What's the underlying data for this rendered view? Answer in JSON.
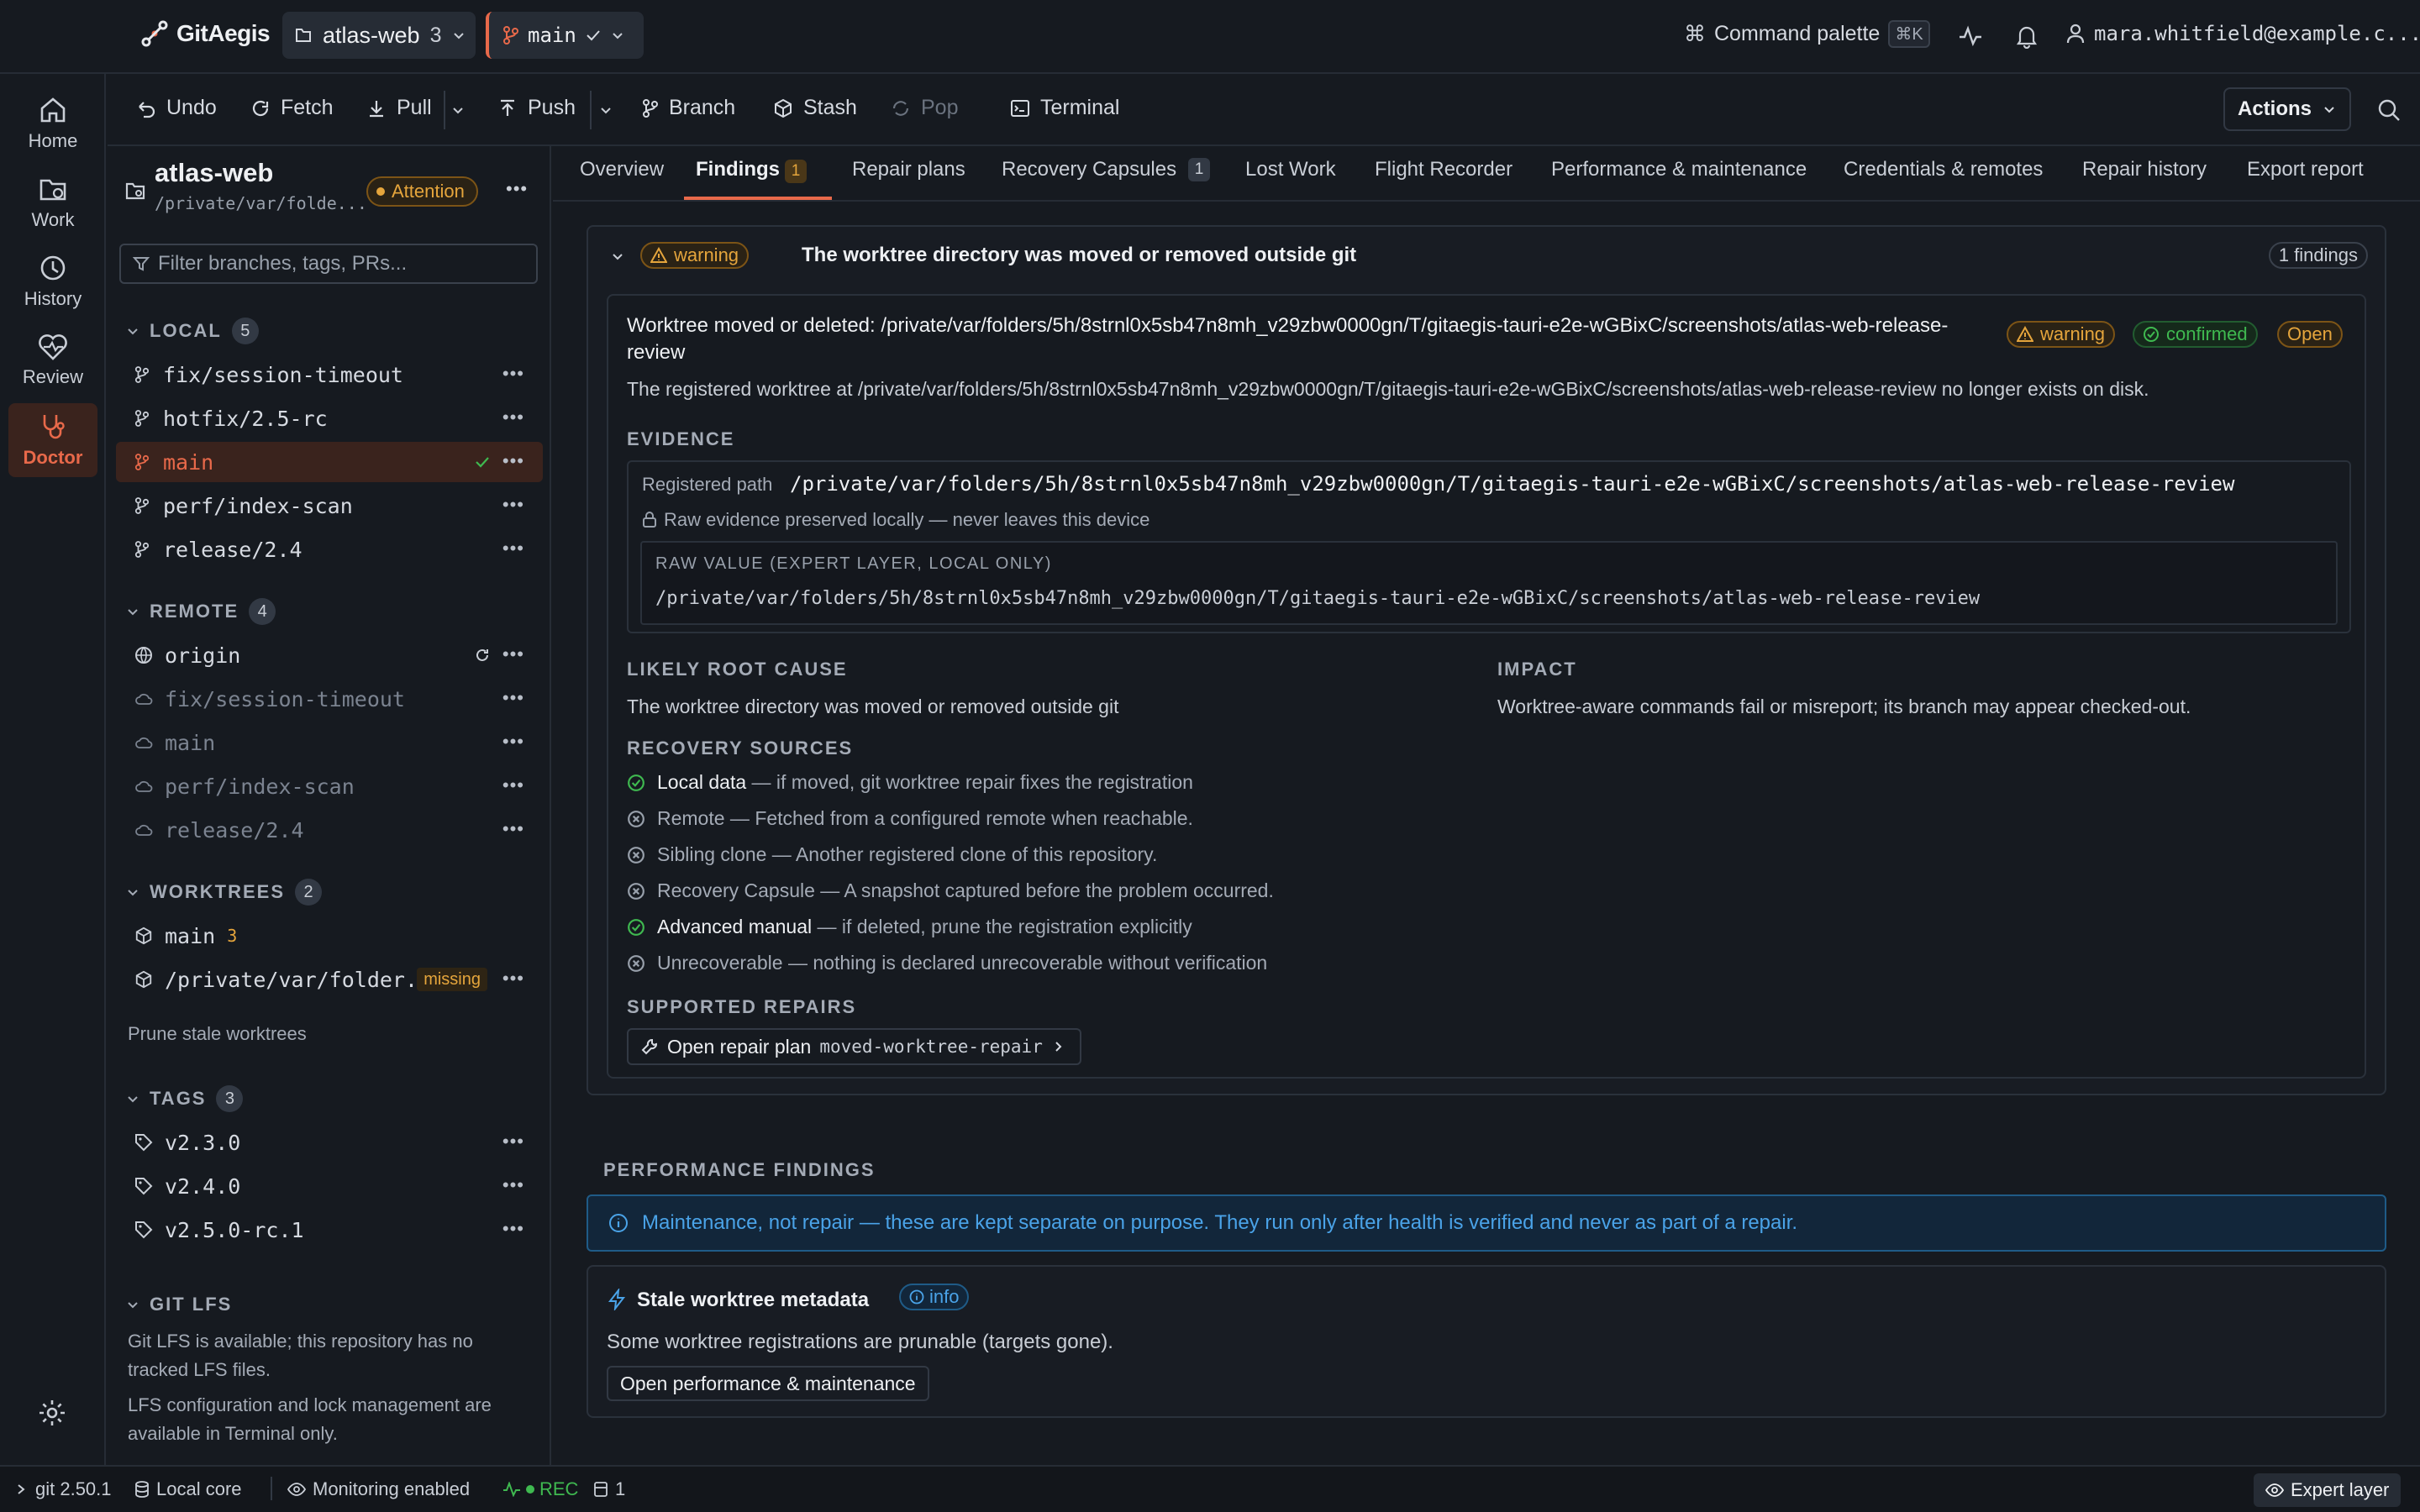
{
  "app": {
    "name": "GitAegis"
  },
  "repo_switch": {
    "name": "atlas-web",
    "count": "3"
  },
  "branch_switch": {
    "name": "main"
  },
  "header": {
    "command_palette": "Command palette",
    "shortcut": "⌘K",
    "user": "mara.whitfield@example.c..."
  },
  "rail": [
    {
      "label": "Home",
      "icon": "home-icon"
    },
    {
      "label": "Work",
      "icon": "work-icon"
    },
    {
      "label": "History",
      "icon": "history-icon"
    },
    {
      "label": "Review",
      "icon": "review-icon"
    },
    {
      "label": "Doctor",
      "icon": "doctor-icon",
      "active": true
    }
  ],
  "toolbar": {
    "undo": "Undo",
    "fetch": "Fetch",
    "pull": "Pull",
    "push": "Push",
    "branch": "Branch",
    "stash": "Stash",
    "pop": "Pop",
    "terminal": "Terminal",
    "actions": "Actions"
  },
  "sidebar": {
    "repo_name": "atlas-web",
    "repo_path": "/private/var/folde...",
    "status": "Attention",
    "filter_placeholder": "Filter branches, tags, PRs...",
    "local": {
      "title": "LOCAL",
      "count": "5",
      "items": [
        "fix/session-timeout",
        "hotfix/2.5-rc",
        "main",
        "perf/index-scan",
        "release/2.4"
      ]
    },
    "remote": {
      "title": "REMOTE",
      "count": "4",
      "origin": "origin",
      "items": [
        "fix/session-timeout",
        "main",
        "perf/index-scan",
        "release/2.4"
      ]
    },
    "worktrees": {
      "title": "WORKTREES",
      "count": "2",
      "main": "main",
      "main_count": "3",
      "other": "/private/var/folder...",
      "other_status": "missing",
      "prune": "Prune stale worktrees"
    },
    "tags": {
      "title": "TAGS",
      "count": "3",
      "items": [
        "v2.3.0",
        "v2.4.0",
        "v2.5.0-rc.1"
      ]
    },
    "lfs": {
      "title": "GIT LFS",
      "text1": "Git LFS is available; this repository has no tracked LFS files.",
      "text2": "LFS configuration and lock management are available in Terminal only."
    }
  },
  "tabs": [
    {
      "label": "Overview"
    },
    {
      "label": "Findings",
      "badge": "1",
      "active": true
    },
    {
      "label": "Repair plans"
    },
    {
      "label": "Recovery Capsules",
      "badge": "1"
    },
    {
      "label": "Lost Work"
    },
    {
      "label": "Flight Recorder"
    },
    {
      "label": "Performance & maintenance"
    },
    {
      "label": "Credentials & remotes"
    },
    {
      "label": "Repair history"
    },
    {
      "label": "Export report"
    }
  ],
  "finding_group": {
    "severity": "warning",
    "title": "The worktree directory was moved or removed outside git",
    "count": "1 findings"
  },
  "finding": {
    "title": "Worktree moved or deleted: /private/var/folders/5h/8strnl0x5sb47n8mh_v29zbw0000gn/T/gitaegis-tauri-e2e-wGBixC/screenshots/atlas-web-release-review",
    "severity": "warning",
    "confidence": "confirmed",
    "state": "Open",
    "description": "The registered worktree at /private/var/folders/5h/8strnl0x5sb47n8mh_v29zbw0000gn/T/gitaegis-tauri-e2e-wGBixC/screenshots/atlas-web-release-review no longer exists on disk.",
    "evidence_title": "EVIDENCE",
    "evidence_label": "Registered path",
    "evidence_value": "/private/var/folders/5h/8strnl0x5sb47n8mh_v29zbw0000gn/T/gitaegis-tauri-e2e-wGBixC/screenshots/atlas-web-release-review",
    "raw_note": "Raw evidence preserved locally — never leaves this device",
    "raw_label": "RAW VALUE (EXPERT LAYER, LOCAL ONLY)",
    "raw_value": "/private/var/folders/5h/8strnl0x5sb47n8mh_v29zbw0000gn/T/gitaegis-tauri-e2e-wGBixC/screenshots/atlas-web-release-review",
    "root_cause_title": "LIKELY ROOT CAUSE",
    "root_cause": "The worktree directory was moved or removed outside git",
    "impact_title": "IMPACT",
    "impact": "Worktree-aware commands fail or misreport; its branch may appear checked-out.",
    "recovery_title": "RECOVERY SOURCES",
    "recovery": [
      {
        "name": "Local data",
        "desc": " — if moved, git worktree repair fixes the registration",
        "ok": true
      },
      {
        "name": "Remote",
        "desc": " — Fetched from a configured remote when reachable.",
        "ok": false
      },
      {
        "name": "Sibling clone",
        "desc": " — Another registered clone of this repository.",
        "ok": false
      },
      {
        "name": "Recovery Capsule",
        "desc": " — A snapshot captured before the problem occurred.",
        "ok": false
      },
      {
        "name": "Advanced manual",
        "desc": " — if deleted, prune the registration explicitly",
        "ok": true
      },
      {
        "name": "Unrecoverable",
        "desc": " — nothing is declared unrecoverable without verification",
        "ok": false
      }
    ],
    "repairs_title": "SUPPORTED REPAIRS",
    "repair_button": "Open repair plan",
    "repair_id": "moved-worktree-repair"
  },
  "performance": {
    "title": "PERFORMANCE FINDINGS",
    "notice": "Maintenance, not repair — these are kept separate on purpose. They run only after health is verified and never as part of a repair.",
    "item_title": "Stale worktree metadata",
    "item_badge": "info",
    "item_desc": "Some worktree registrations are prunable (targets gone).",
    "item_button": "Open performance & maintenance"
  },
  "statusbar": {
    "git": "git 2.50.1",
    "core": "Local core",
    "monitoring": "Monitoring enabled",
    "rec": "REC",
    "count": "1",
    "expert": "Expert layer"
  },
  "colors": {
    "accent": "#e8694a",
    "warning": "#e5a53c",
    "success": "#3fb950",
    "info": "#4aa3e8"
  }
}
